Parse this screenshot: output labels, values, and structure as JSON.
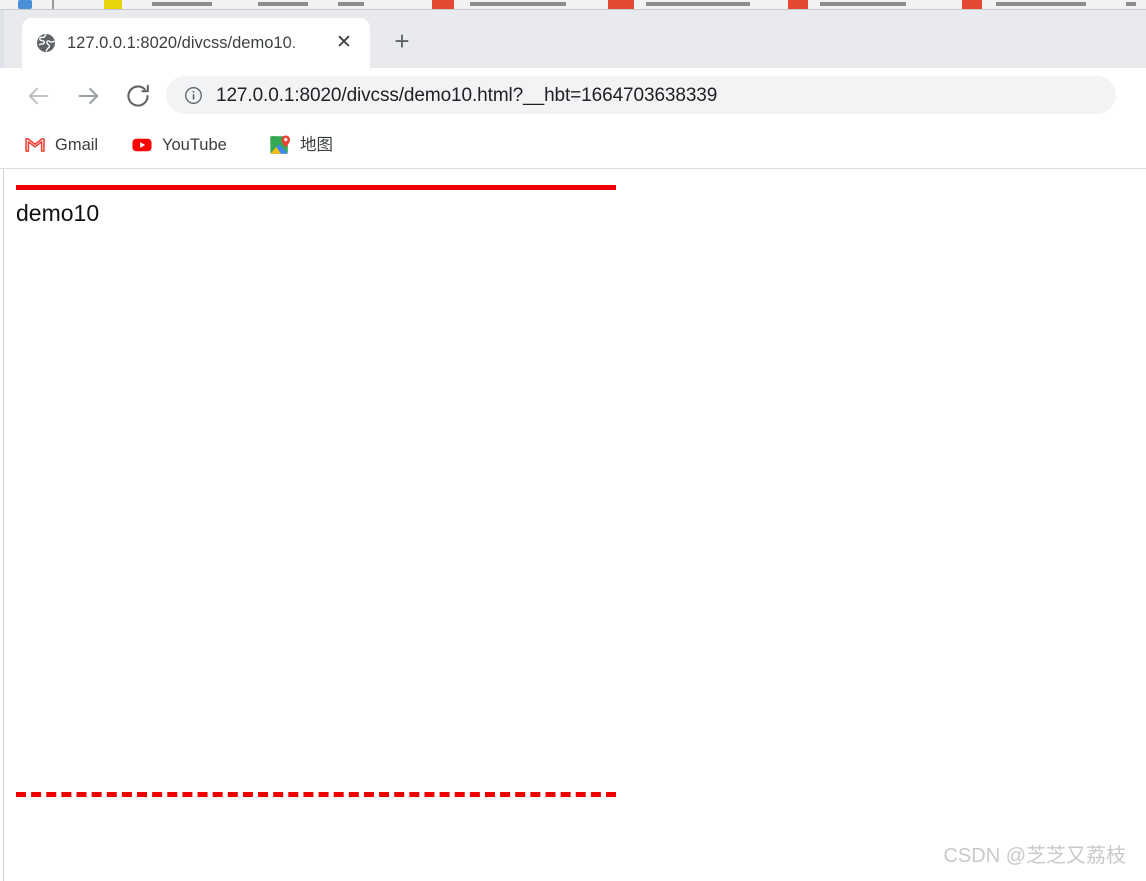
{
  "browser": {
    "tab": {
      "title": "127.0.0.1:8020/divcss/demo10.",
      "favicon_name": "globe-icon",
      "close_label": "✕"
    },
    "new_tab_label": "+",
    "toolbar": {
      "back_name": "back-arrow-icon",
      "forward_name": "forward-arrow-icon",
      "reload_name": "reload-icon",
      "site_info_name": "info-circle-icon",
      "url": "127.0.0.1:8020/divcss/demo10.html?__hbt=1664703638339"
    },
    "bookmarks": [
      {
        "label": "Gmail",
        "icon": "gmail-icon"
      },
      {
        "label": "YouTube",
        "icon": "youtube-icon"
      },
      {
        "label": "地图",
        "icon": "google-maps-icon"
      }
    ]
  },
  "page": {
    "heading": "demo10",
    "border_color": "#ee0000",
    "border_top_style": "solid",
    "border_bottom_style": "dashed",
    "border_width_px": "5",
    "box_width_px": "600"
  },
  "watermark": {
    "text": "CSDN @芝芝又荔枝"
  }
}
